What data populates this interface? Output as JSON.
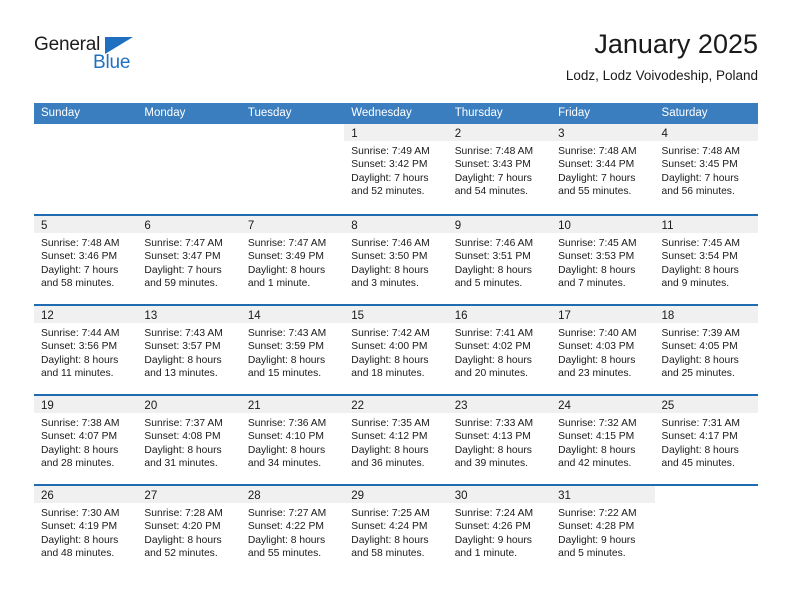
{
  "brand": {
    "name_top": "General",
    "name_bottom": "Blue",
    "triangle_color": "#1f70c1",
    "text_color": "#1c1c1c"
  },
  "header": {
    "title": "January 2025",
    "subtitle": "Lodz, Lodz Voivodeship, Poland"
  },
  "theme": {
    "header_blue": "#3a7ebf",
    "row_rule_blue": "#1f6cb0",
    "day_band_gray": "#f0f0f0"
  },
  "weekdays": [
    "Sunday",
    "Monday",
    "Tuesday",
    "Wednesday",
    "Thursday",
    "Friday",
    "Saturday"
  ],
  "weeks": [
    [
      {
        "blank": true,
        "day": "",
        "l1": "",
        "l2": "",
        "l3": "",
        "l4": ""
      },
      {
        "blank": true,
        "day": "",
        "l1": "",
        "l2": "",
        "l3": "",
        "l4": ""
      },
      {
        "blank": true,
        "day": "",
        "l1": "",
        "l2": "",
        "l3": "",
        "l4": ""
      },
      {
        "blank": false,
        "day": "1",
        "l1": "Sunrise: 7:49 AM",
        "l2": "Sunset: 3:42 PM",
        "l3": "Daylight: 7 hours",
        "l4": "and 52 minutes."
      },
      {
        "blank": false,
        "day": "2",
        "l1": "Sunrise: 7:48 AM",
        "l2": "Sunset: 3:43 PM",
        "l3": "Daylight: 7 hours",
        "l4": "and 54 minutes."
      },
      {
        "blank": false,
        "day": "3",
        "l1": "Sunrise: 7:48 AM",
        "l2": "Sunset: 3:44 PM",
        "l3": "Daylight: 7 hours",
        "l4": "and 55 minutes."
      },
      {
        "blank": false,
        "day": "4",
        "l1": "Sunrise: 7:48 AM",
        "l2": "Sunset: 3:45 PM",
        "l3": "Daylight: 7 hours",
        "l4": "and 56 minutes."
      }
    ],
    [
      {
        "blank": false,
        "day": "5",
        "l1": "Sunrise: 7:48 AM",
        "l2": "Sunset: 3:46 PM",
        "l3": "Daylight: 7 hours",
        "l4": "and 58 minutes."
      },
      {
        "blank": false,
        "day": "6",
        "l1": "Sunrise: 7:47 AM",
        "l2": "Sunset: 3:47 PM",
        "l3": "Daylight: 7 hours",
        "l4": "and 59 minutes."
      },
      {
        "blank": false,
        "day": "7",
        "l1": "Sunrise: 7:47 AM",
        "l2": "Sunset: 3:49 PM",
        "l3": "Daylight: 8 hours",
        "l4": "and 1 minute."
      },
      {
        "blank": false,
        "day": "8",
        "l1": "Sunrise: 7:46 AM",
        "l2": "Sunset: 3:50 PM",
        "l3": "Daylight: 8 hours",
        "l4": "and 3 minutes."
      },
      {
        "blank": false,
        "day": "9",
        "l1": "Sunrise: 7:46 AM",
        "l2": "Sunset: 3:51 PM",
        "l3": "Daylight: 8 hours",
        "l4": "and 5 minutes."
      },
      {
        "blank": false,
        "day": "10",
        "l1": "Sunrise: 7:45 AM",
        "l2": "Sunset: 3:53 PM",
        "l3": "Daylight: 8 hours",
        "l4": "and 7 minutes."
      },
      {
        "blank": false,
        "day": "11",
        "l1": "Sunrise: 7:45 AM",
        "l2": "Sunset: 3:54 PM",
        "l3": "Daylight: 8 hours",
        "l4": "and 9 minutes."
      }
    ],
    [
      {
        "blank": false,
        "day": "12",
        "l1": "Sunrise: 7:44 AM",
        "l2": "Sunset: 3:56 PM",
        "l3": "Daylight: 8 hours",
        "l4": "and 11 minutes."
      },
      {
        "blank": false,
        "day": "13",
        "l1": "Sunrise: 7:43 AM",
        "l2": "Sunset: 3:57 PM",
        "l3": "Daylight: 8 hours",
        "l4": "and 13 minutes."
      },
      {
        "blank": false,
        "day": "14",
        "l1": "Sunrise: 7:43 AM",
        "l2": "Sunset: 3:59 PM",
        "l3": "Daylight: 8 hours",
        "l4": "and 15 minutes."
      },
      {
        "blank": false,
        "day": "15",
        "l1": "Sunrise: 7:42 AM",
        "l2": "Sunset: 4:00 PM",
        "l3": "Daylight: 8 hours",
        "l4": "and 18 minutes."
      },
      {
        "blank": false,
        "day": "16",
        "l1": "Sunrise: 7:41 AM",
        "l2": "Sunset: 4:02 PM",
        "l3": "Daylight: 8 hours",
        "l4": "and 20 minutes."
      },
      {
        "blank": false,
        "day": "17",
        "l1": "Sunrise: 7:40 AM",
        "l2": "Sunset: 4:03 PM",
        "l3": "Daylight: 8 hours",
        "l4": "and 23 minutes."
      },
      {
        "blank": false,
        "day": "18",
        "l1": "Sunrise: 7:39 AM",
        "l2": "Sunset: 4:05 PM",
        "l3": "Daylight: 8 hours",
        "l4": "and 25 minutes."
      }
    ],
    [
      {
        "blank": false,
        "day": "19",
        "l1": "Sunrise: 7:38 AM",
        "l2": "Sunset: 4:07 PM",
        "l3": "Daylight: 8 hours",
        "l4": "and 28 minutes."
      },
      {
        "blank": false,
        "day": "20",
        "l1": "Sunrise: 7:37 AM",
        "l2": "Sunset: 4:08 PM",
        "l3": "Daylight: 8 hours",
        "l4": "and 31 minutes."
      },
      {
        "blank": false,
        "day": "21",
        "l1": "Sunrise: 7:36 AM",
        "l2": "Sunset: 4:10 PM",
        "l3": "Daylight: 8 hours",
        "l4": "and 34 minutes."
      },
      {
        "blank": false,
        "day": "22",
        "l1": "Sunrise: 7:35 AM",
        "l2": "Sunset: 4:12 PM",
        "l3": "Daylight: 8 hours",
        "l4": "and 36 minutes."
      },
      {
        "blank": false,
        "day": "23",
        "l1": "Sunrise: 7:33 AM",
        "l2": "Sunset: 4:13 PM",
        "l3": "Daylight: 8 hours",
        "l4": "and 39 minutes."
      },
      {
        "blank": false,
        "day": "24",
        "l1": "Sunrise: 7:32 AM",
        "l2": "Sunset: 4:15 PM",
        "l3": "Daylight: 8 hours",
        "l4": "and 42 minutes."
      },
      {
        "blank": false,
        "day": "25",
        "l1": "Sunrise: 7:31 AM",
        "l2": "Sunset: 4:17 PM",
        "l3": "Daylight: 8 hours",
        "l4": "and 45 minutes."
      }
    ],
    [
      {
        "blank": false,
        "day": "26",
        "l1": "Sunrise: 7:30 AM",
        "l2": "Sunset: 4:19 PM",
        "l3": "Daylight: 8 hours",
        "l4": "and 48 minutes."
      },
      {
        "blank": false,
        "day": "27",
        "l1": "Sunrise: 7:28 AM",
        "l2": "Sunset: 4:20 PM",
        "l3": "Daylight: 8 hours",
        "l4": "and 52 minutes."
      },
      {
        "blank": false,
        "day": "28",
        "l1": "Sunrise: 7:27 AM",
        "l2": "Sunset: 4:22 PM",
        "l3": "Daylight: 8 hours",
        "l4": "and 55 minutes."
      },
      {
        "blank": false,
        "day": "29",
        "l1": "Sunrise: 7:25 AM",
        "l2": "Sunset: 4:24 PM",
        "l3": "Daylight: 8 hours",
        "l4": "and 58 minutes."
      },
      {
        "blank": false,
        "day": "30",
        "l1": "Sunrise: 7:24 AM",
        "l2": "Sunset: 4:26 PM",
        "l3": "Daylight: 9 hours",
        "l4": "and 1 minute."
      },
      {
        "blank": false,
        "day": "31",
        "l1": "Sunrise: 7:22 AM",
        "l2": "Sunset: 4:28 PM",
        "l3": "Daylight: 9 hours",
        "l4": "and 5 minutes."
      },
      {
        "blank": true,
        "day": "",
        "l1": "",
        "l2": "",
        "l3": "",
        "l4": ""
      }
    ]
  ]
}
